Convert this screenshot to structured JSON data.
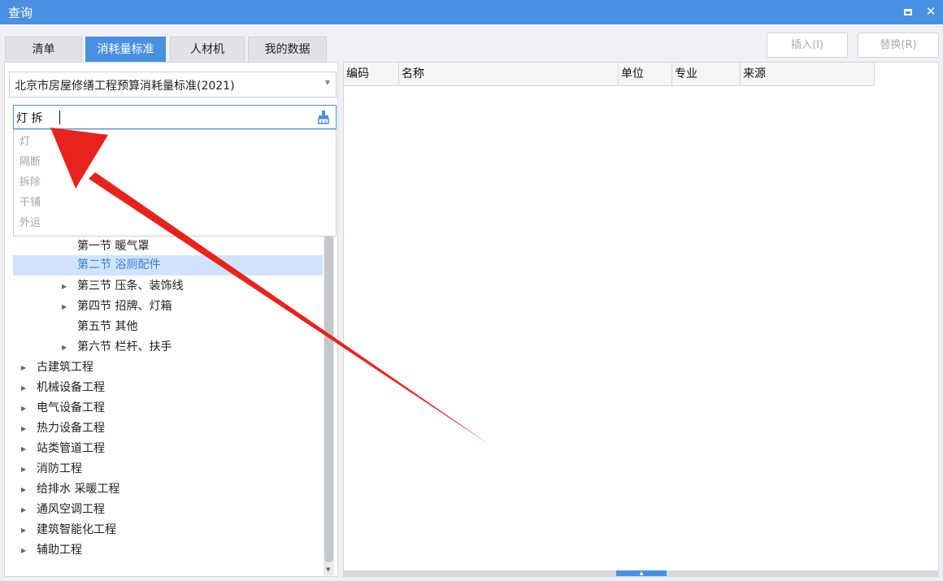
{
  "window": {
    "title": "查询"
  },
  "tabs": [
    {
      "label": "清单",
      "active": false
    },
    {
      "label": "消耗量标准",
      "active": true
    },
    {
      "label": "人材机",
      "active": false
    },
    {
      "label": "我的数据",
      "active": false
    }
  ],
  "toolbar": {
    "insert_label": "插入(I)",
    "replace_label": "替换(R)"
  },
  "standard_select": {
    "value": "北京市房屋修缮工程预算消耗量标准(2021)"
  },
  "search": {
    "value": "灯 拆",
    "icon": "brush-icon"
  },
  "suggestions": [
    "灯",
    "隔断",
    "拆除",
    "干铺",
    "外运"
  ],
  "tree": {
    "subsections": [
      {
        "label": "第一节 暖气罩",
        "expandable": false
      },
      {
        "label": "第二节 浴厕配件",
        "expandable": false,
        "selected": true
      },
      {
        "label": "第三节 压条、装饰线",
        "expandable": true
      },
      {
        "label": "第四节 招牌、灯箱",
        "expandable": true
      },
      {
        "label": "第五节 其他",
        "expandable": false
      },
      {
        "label": "第六节 栏杆、扶手",
        "expandable": true
      }
    ],
    "categories": [
      "古建筑工程",
      "机械设备工程",
      "电气设备工程",
      "热力设备工程",
      "站类管道工程",
      "消防工程",
      "给排水 采暖工程",
      "通风空调工程",
      "建筑智能化工程",
      "辅助工程"
    ]
  },
  "table": {
    "columns": [
      "编码",
      "名称",
      "单位",
      "专业",
      "来源"
    ]
  },
  "colors": {
    "accent": "#4a90e2",
    "annotation_arrow": "#e8231e",
    "selected_row": "#cfe3fb"
  }
}
